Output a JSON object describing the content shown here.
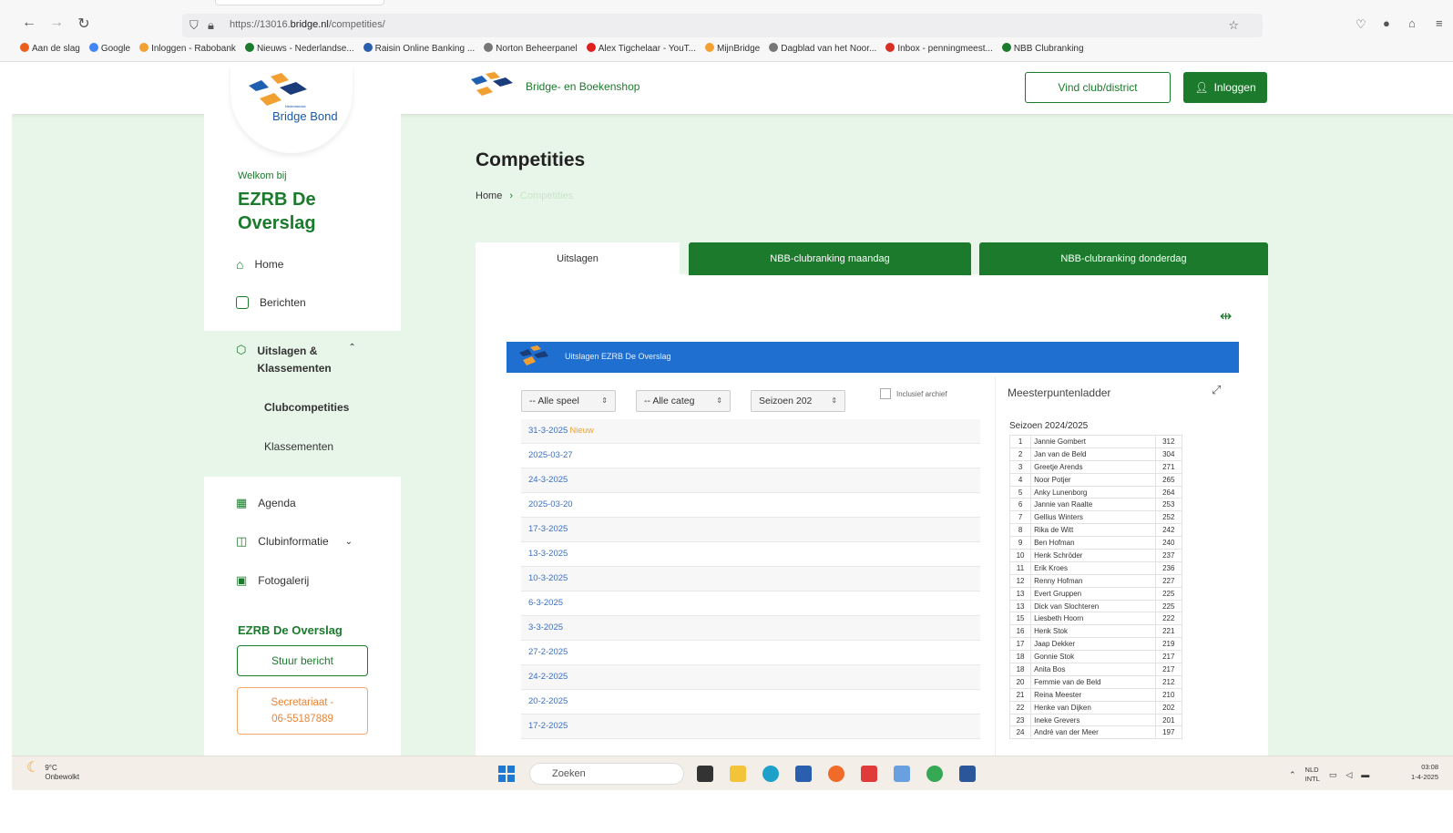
{
  "browser": {
    "url_prefix": "https://13016.",
    "url_domain": "bridge.nl",
    "url_path": "/competities/",
    "bookmarks": [
      {
        "label": "Aan de slag",
        "color": "#e8601c"
      },
      {
        "label": "Google",
        "color": "#4285f4"
      },
      {
        "label": "Inloggen - Rabobank",
        "color": "#f3a033"
      },
      {
        "label": "Nieuws - Nederlandse...",
        "color": "#1b7a2c"
      },
      {
        "label": "Raisin Online Banking ...",
        "color": "#2a5fb0"
      },
      {
        "label": "Norton Beheerpanel",
        "color": "#777777"
      },
      {
        "label": "Alex Tigchelaar - YouT...",
        "color": "#e02020"
      },
      {
        "label": "MijnBridge",
        "color": "#f3a033"
      },
      {
        "label": "Dagblad van het Noor...",
        "color": "#777777"
      },
      {
        "label": "Inbox - penningmeest...",
        "color": "#d93025"
      },
      {
        "label": "NBB Clubranking",
        "color": "#1b7a2c"
      }
    ]
  },
  "header": {
    "logo_text": "Bridge Bond",
    "logo_small": "Nederlandse",
    "shop_label": "Bridge- en Boekenshop",
    "find_club_label": "Vind club/district",
    "login_label": "Inloggen"
  },
  "sidebar": {
    "welcome": "Welkom bij",
    "club_name": "EZRB De Overslag",
    "items": [
      {
        "label": "Home",
        "icon": "home-icon"
      },
      {
        "label": "Berichten",
        "icon": "message-icon"
      },
      {
        "label": "Uitslagen & Klassementen",
        "icon": "trophy-icon"
      },
      {
        "label": "Clubcompetities"
      },
      {
        "label": "Klassementen"
      },
      {
        "label": "Agenda",
        "icon": "calendar-icon"
      },
      {
        "label": "Clubinformatie",
        "icon": "info-icon"
      },
      {
        "label": "Fotogalerij",
        "icon": "photo-icon"
      }
    ],
    "club_section": "EZRB De Overslag",
    "send_label": "Stuur bericht",
    "secretary_line1": "Secretariaat -",
    "secretary_line2": "06-55187889"
  },
  "main": {
    "title": "Competities",
    "breadcrumb_home": "Home",
    "breadcrumb_current": "Competities",
    "tabs": [
      "Uitslagen",
      "NBB-clubranking maandag",
      "NBB-clubranking donderdag"
    ],
    "widget_title": "Uitslagen EZRB De Overslag",
    "filter_speel": "-- Alle speel",
    "filter_categ": "-- Alle categ",
    "filter_seizoen": "Seizoen 202",
    "archive_label": "Inclusief archief",
    "new_label": "Nieuw",
    "dates": [
      "31-3-2025",
      "2025-03-27",
      "24-3-2025",
      "2025-03-20",
      "17-3-2025",
      "13-3-2025",
      "10-3-2025",
      "6-3-2025",
      "3-3-2025",
      "27-2-2025",
      "24-2-2025",
      "20-2-2025",
      "17-2-2025"
    ]
  },
  "ladder": {
    "title": "Meesterpuntenladder",
    "season": "Seizoen 2024/2025",
    "rows": [
      {
        "rank": "1",
        "name": "Jannie Gombert",
        "points": "312"
      },
      {
        "rank": "2",
        "name": "Jan van de Beld",
        "points": "304"
      },
      {
        "rank": "3",
        "name": "Greetje Arends",
        "points": "271"
      },
      {
        "rank": "4",
        "name": "Noor Potjer",
        "points": "265"
      },
      {
        "rank": "5",
        "name": "Anky Lunenborg",
        "points": "264"
      },
      {
        "rank": "6",
        "name": "Jannie van Raalte",
        "points": "253"
      },
      {
        "rank": "7",
        "name": "Gellius Winters",
        "points": "252"
      },
      {
        "rank": "8",
        "name": "Rika de Witt",
        "points": "242"
      },
      {
        "rank": "9",
        "name": "Ben Hofman",
        "points": "240"
      },
      {
        "rank": "10",
        "name": "Henk Schröder",
        "points": "237"
      },
      {
        "rank": "11",
        "name": "Erik Kroes",
        "points": "236"
      },
      {
        "rank": "12",
        "name": "Renny Hofman",
        "points": "227"
      },
      {
        "rank": "13",
        "name": "Evert Gruppen",
        "points": "225"
      },
      {
        "rank": "13",
        "name": "Dick van Slochteren",
        "points": "225"
      },
      {
        "rank": "15",
        "name": "Liesbeth Hoorn",
        "points": "222"
      },
      {
        "rank": "16",
        "name": "Henk Stok",
        "points": "221"
      },
      {
        "rank": "17",
        "name": "Jaap Dekker",
        "points": "219"
      },
      {
        "rank": "18",
        "name": "Gonnie Stok",
        "points": "217"
      },
      {
        "rank": "18",
        "name": "Anita Bos",
        "points": "217"
      },
      {
        "rank": "20",
        "name": "Femmie van de Beld",
        "points": "212"
      },
      {
        "rank": "21",
        "name": "Reina Meester",
        "points": "210"
      },
      {
        "rank": "22",
        "name": "Henke van Dijken",
        "points": "202"
      },
      {
        "rank": "23",
        "name": "Ineke Grevers",
        "points": "201"
      },
      {
        "rank": "24",
        "name": "André van der Meer",
        "points": "197"
      }
    ]
  },
  "taskbar": {
    "temp": "9°C",
    "weather": "Onbewolkt",
    "search_placeholder": "Zoeken",
    "lang1": "NLD",
    "lang2": "INTL",
    "time": "03:08",
    "date": "1-4-2025"
  },
  "colors": {
    "brand_green": "#1b7a2c",
    "page_bg": "#e8f5e9",
    "widget_blue": "#1f6fd1",
    "accent_orange": "#e8853a"
  }
}
